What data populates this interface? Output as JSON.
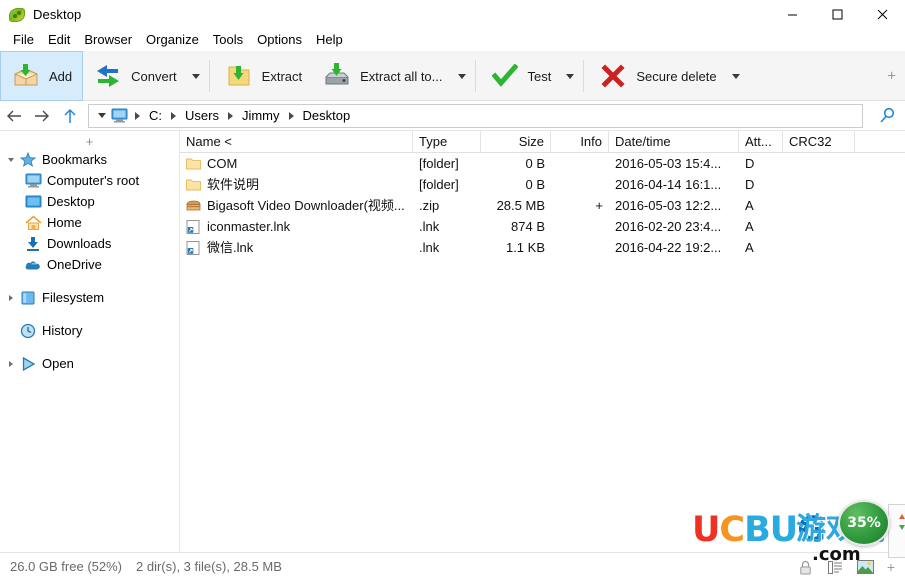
{
  "window": {
    "title": "Desktop",
    "icon": "peazip-icon",
    "buttons": {
      "minimize": "minimize-icon",
      "maximize": "maximize-icon",
      "close": "close-icon"
    }
  },
  "menubar": {
    "items": [
      {
        "label": "File"
      },
      {
        "label": "Edit"
      },
      {
        "label": "Browser"
      },
      {
        "label": "Organize"
      },
      {
        "label": "Tools"
      },
      {
        "label": "Options"
      },
      {
        "label": "Help"
      }
    ]
  },
  "toolbar": {
    "add_label": "Add",
    "convert_label": "Convert",
    "extract_label": "Extract",
    "extract_all_label": "Extract all to...",
    "test_label": "Test",
    "secure_delete_label": "Secure delete",
    "plus_label": "+"
  },
  "addressbar": {
    "back_icon": "arrow-left-icon",
    "forward_icon": "arrow-right-icon",
    "up_icon": "arrow-up-icon",
    "computer_icon": "computer-icon",
    "search_icon": "search-icon",
    "crumbs": [
      "C:",
      "Users",
      "Jimmy",
      "Desktop"
    ]
  },
  "sidebar": {
    "plus_label": "+",
    "groups": [
      {
        "label": "Bookmarks",
        "icon": "star-icon",
        "expanded": true,
        "children": [
          {
            "label": "Computer's root",
            "icon": "computer-icon"
          },
          {
            "label": "Desktop",
            "icon": "desktop-icon"
          },
          {
            "label": "Home",
            "icon": "home-icon"
          },
          {
            "label": "Downloads",
            "icon": "download-icon"
          },
          {
            "label": "OneDrive",
            "icon": "cloud-icon"
          }
        ]
      },
      {
        "label": "Filesystem",
        "icon": "folder-blue-icon",
        "expanded": false,
        "children": []
      },
      {
        "label": "History",
        "icon": "clock-icon",
        "expanded": null,
        "children": []
      },
      {
        "label": "Open",
        "icon": "play-icon",
        "expanded": false,
        "children": []
      }
    ]
  },
  "filelist": {
    "columns": [
      {
        "key": "name",
        "label": "Name <",
        "align": "left"
      },
      {
        "key": "type",
        "label": "Type",
        "align": "left"
      },
      {
        "key": "size",
        "label": "Size",
        "align": "right"
      },
      {
        "key": "info",
        "label": "Info",
        "align": "right"
      },
      {
        "key": "date",
        "label": "Date/time",
        "align": "left"
      },
      {
        "key": "att",
        "label": "Att...",
        "align": "left"
      },
      {
        "key": "crc",
        "label": "CRC32",
        "align": "left"
      }
    ],
    "rows": [
      {
        "icon": "folder-icon",
        "name": "COM",
        "type": "[folder]",
        "size": "0 B",
        "info": "",
        "date": "2016-05-03 15:4...",
        "att": "D",
        "crc": ""
      },
      {
        "icon": "folder-icon",
        "name": "软件说明",
        "type": "[folder]",
        "size": "0 B",
        "info": "",
        "date": "2016-04-14 16:1...",
        "att": "D",
        "crc": ""
      },
      {
        "icon": "archive-icon",
        "name": "Bigasoft Video Downloader(视频...",
        "type": ".zip",
        "size": "28.5 MB",
        "info": "+",
        "date": "2016-05-03 12:2...",
        "att": "A",
        "crc": ""
      },
      {
        "icon": "shortcut-icon",
        "name": "iconmaster.lnk",
        "type": ".lnk",
        "size": "874 B",
        "info": "",
        "date": "2016-02-20 23:4...",
        "att": "A",
        "crc": ""
      },
      {
        "icon": "shortcut-icon",
        "name": "微信.lnk",
        "type": ".lnk",
        "size": "1.1 KB",
        "info": "",
        "date": "2016-04-22 19:2...",
        "att": "A",
        "crc": ""
      }
    ]
  },
  "statusbar": {
    "free_space": "26.0 GB free (52%)",
    "selection": "2 dir(s), 3 file(s), 28.5 MB",
    "lock_icon": "lock-icon",
    "list_icon": "list-view-icon",
    "image_icon": "image-preview-icon",
    "plus_label": "+"
  },
  "watermark": {
    "uc": "UC",
    "bug": "BUG",
    "chinese": "游戏网",
    "com": ".com",
    "percent": "35%"
  }
}
